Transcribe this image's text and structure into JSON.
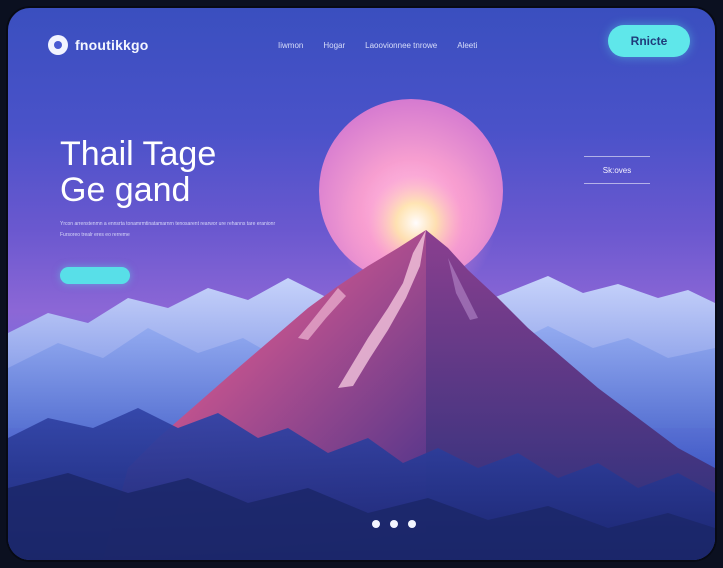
{
  "nav": {
    "logo_text": "fnoutikkgo",
    "menu": [
      "Iiwmon",
      "Hogar",
      "Laoovionnee tnrowe",
      "Aleeti"
    ],
    "cta_label": "Rnicte"
  },
  "hero": {
    "title_line1": "Thail Tage",
    "title_line2": "Ge gand",
    "description": "Yrcon arrenstenmn a ennsrta tonamrmtinatamarnrn tenosarent rearwor ure rehanns tare eranionr Fursoreo trealr eres eo rerreme",
    "button_label": ""
  },
  "tag_label": "Sk:oves",
  "colors": {
    "accent": "#5fe7ea",
    "sky_top": "#3a4fbf",
    "sky_mid": "#8c67d6",
    "sun": "#f2a0cf"
  },
  "carousel": {
    "dots": 3
  }
}
